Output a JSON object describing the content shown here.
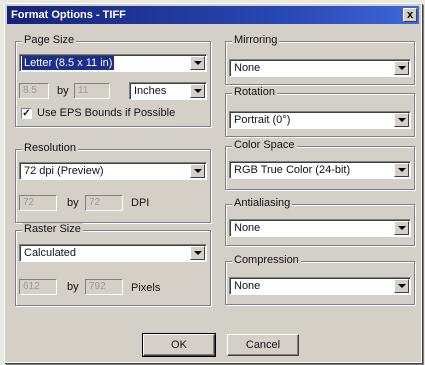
{
  "window": {
    "title": "Format Options - TIFF",
    "close_glyph": "x"
  },
  "page_size": {
    "group_label": "Page Size",
    "paper": "Letter (8.5 x 11 in)",
    "width": "8.5",
    "by": "by",
    "height": "11",
    "units": "Inches",
    "eps_checked": true,
    "eps_label": "Use EPS Bounds if Possible"
  },
  "resolution": {
    "group_label": "Resolution",
    "value": "72 dpi (Preview)",
    "x": "72",
    "by": "by",
    "y": "72",
    "unit": "DPI"
  },
  "raster_size": {
    "group_label": "Raster Size",
    "value": "Calculated",
    "w": "612",
    "by": "by",
    "h": "792",
    "unit": "Pixels"
  },
  "mirroring": {
    "group_label": "Mirroring",
    "value": "None"
  },
  "rotation": {
    "group_label": "Rotation",
    "value": "Portrait (0°)"
  },
  "color_space": {
    "group_label": "Color Space",
    "value": "RGB True Color (24-bit)"
  },
  "antialiasing": {
    "group_label": "Antialiasing",
    "value": "None"
  },
  "compression": {
    "group_label": "Compression",
    "value": "None"
  },
  "buttons": {
    "ok": "OK",
    "cancel": "Cancel"
  }
}
